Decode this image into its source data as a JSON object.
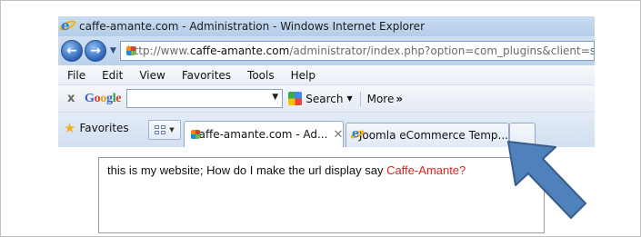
{
  "window": {
    "title": "caffe-amante.com - Administration - Windows Internet Explorer"
  },
  "address_bar": {
    "url_prefix": "http://www.",
    "url_host": "caffe-amante.com",
    "url_path": "/administrator/index.php?option=com_plugins&client=site"
  },
  "menu": {
    "items": [
      "File",
      "Edit",
      "View",
      "Favorites",
      "Tools",
      "Help"
    ]
  },
  "google_toolbar": {
    "close": "x",
    "logo_letters": [
      "G",
      "o",
      "o",
      "g",
      "l",
      "e"
    ],
    "logo_colors": [
      "#3b5fd6",
      "#d93a2b",
      "#e4a600",
      "#3b5fd6",
      "#2e9b3f",
      "#d93a2b"
    ],
    "search_label": "Search",
    "more_label": "More"
  },
  "tabs_bar": {
    "favorites_label": "Favorites",
    "tabs": [
      {
        "label": "caffe-amante.com - Ad...",
        "active": true
      },
      {
        "label": "Joomla eCommerce Temp...",
        "active": false
      }
    ]
  },
  "note": {
    "text": "this is my website; How do I make  the url display say ",
    "highlight": "Caffe-Amante?",
    "highlight_color": "#e02020"
  },
  "colors": {
    "arrow_fill": "#4f81bd",
    "arrow_stroke": "#385d8a"
  }
}
